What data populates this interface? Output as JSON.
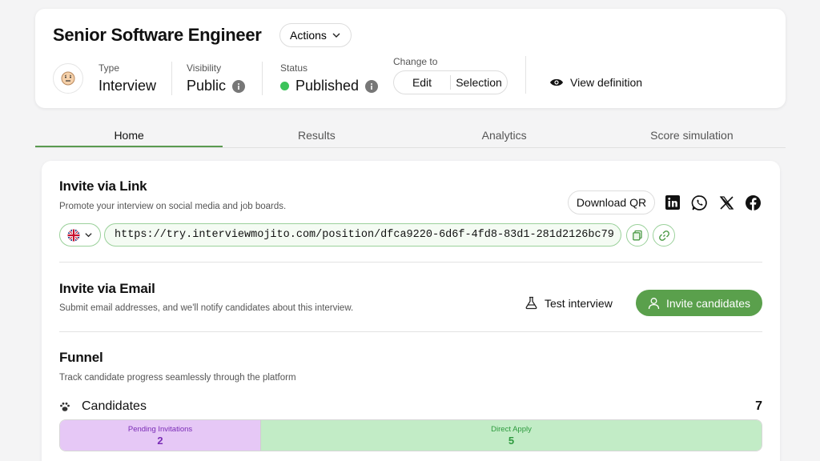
{
  "header": {
    "title": "Senior Software Engineer",
    "actions_label": "Actions",
    "type": {
      "label": "Type",
      "value": "Interview"
    },
    "visibility": {
      "label": "Visibility",
      "value": "Public"
    },
    "status": {
      "label": "Status",
      "value": "Published",
      "color": "#3cc35a"
    },
    "change_to": {
      "label": "Change to",
      "options": [
        "Edit",
        "Selection"
      ]
    },
    "view_definition": "View definition"
  },
  "tabs": [
    {
      "label": "Home",
      "active": true
    },
    {
      "label": "Results",
      "active": false
    },
    {
      "label": "Analytics",
      "active": false
    },
    {
      "label": "Score simulation",
      "active": false
    }
  ],
  "invite_link": {
    "title": "Invite via Link",
    "subtitle": "Promote your interview on social media and job boards.",
    "download_qr": "Download QR",
    "socials": [
      "linkedin-icon",
      "whatsapp-icon",
      "x-icon",
      "facebook-icon"
    ],
    "url": "https://try.interviewmojito.com/position/dfca9220-6d6f-4fd8-83d1-281d2126bc79"
  },
  "invite_email": {
    "title": "Invite via Email",
    "subtitle": "Submit email addresses, and we'll notify candidates about this interview.",
    "test_interview": "Test interview",
    "invite_candidates": "Invite candidates"
  },
  "funnel": {
    "title": "Funnel",
    "subtitle": "Track candidate progress seamlessly through the platform",
    "candidates_label": "Candidates",
    "candidates_count": "7",
    "segments": [
      {
        "label": "Pending Invitations",
        "value": "2",
        "color": "#e6c8f6"
      },
      {
        "label": "Direct Apply",
        "value": "5",
        "color": "#c2ecc6"
      }
    ]
  },
  "colors": {
    "accent": "#5aa04c",
    "accent_light": "#9bd19b"
  }
}
